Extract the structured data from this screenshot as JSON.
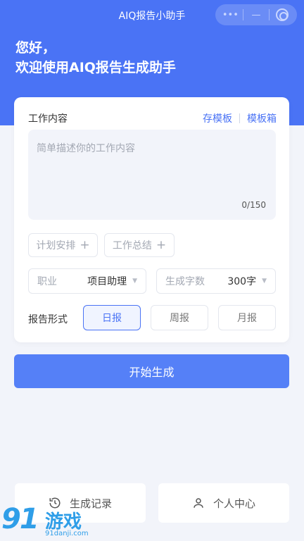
{
  "topbar": {
    "title": "AIQ报告小助手",
    "capsule": {
      "more": "•••",
      "minimize": "—"
    }
  },
  "greeting": {
    "line1": "您好，",
    "line2": "欢迎使用AIQ报告生成助手"
  },
  "work": {
    "label": "工作内容",
    "save_template": "存模板",
    "template_box": "模板箱",
    "placeholder": "简单描述你的工作内容",
    "counter": "0/150"
  },
  "chips": [
    {
      "label": "计划安排",
      "plus": "+"
    },
    {
      "label": "工作总结",
      "plus": "+"
    }
  ],
  "occupation": {
    "label": "职业",
    "value": "项目助理",
    "caret": "▼"
  },
  "word_count": {
    "label": "生成字数",
    "value": "300字",
    "caret": "▼"
  },
  "report_format": {
    "label": "报告形式",
    "options": [
      "日报",
      "周报",
      "月报"
    ],
    "selected": "日报"
  },
  "start_button": "开始生成",
  "bottom_nav": {
    "history": "生成记录",
    "profile": "个人中心"
  },
  "watermark": {
    "logo_number": "91",
    "logo_text": "游戏",
    "url": "91danji.com"
  },
  "colors": {
    "primary": "#4a73f5",
    "button": "#5580f7",
    "background": "#f2f4fa"
  }
}
